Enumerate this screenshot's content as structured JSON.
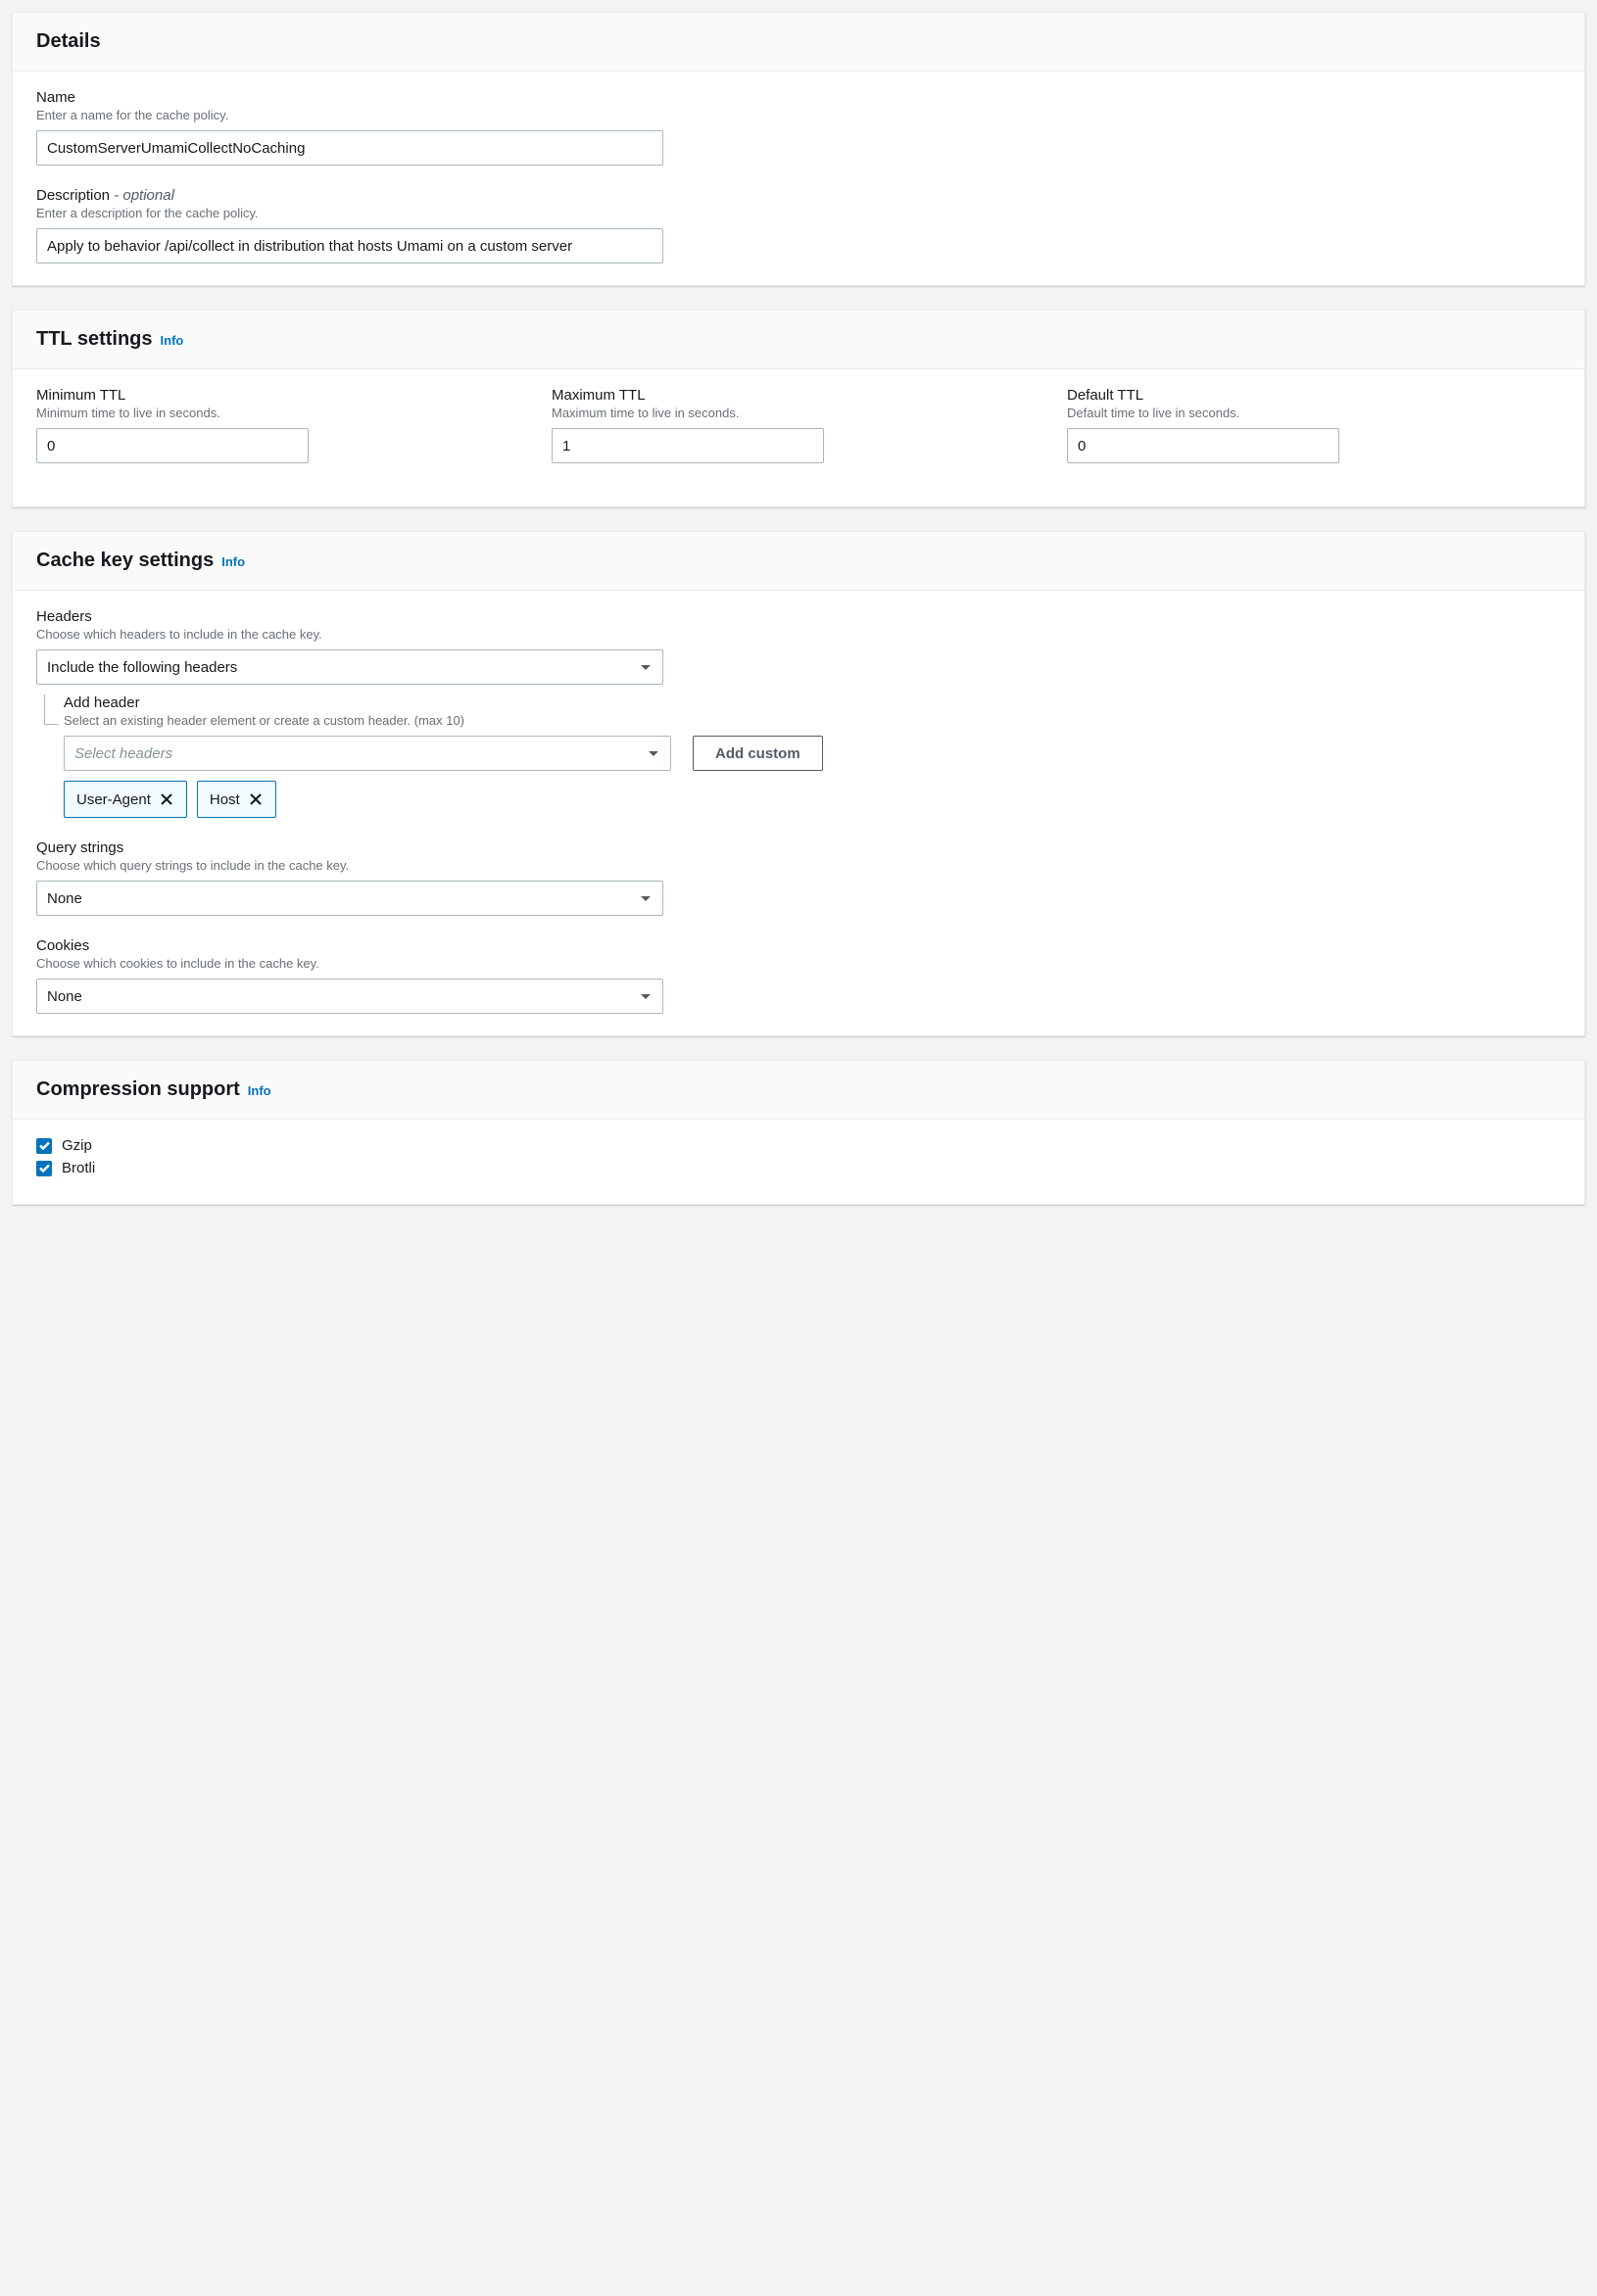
{
  "details": {
    "title": "Details",
    "name": {
      "label": "Name",
      "help": "Enter a name for the cache policy.",
      "value": "CustomServerUmamiCollectNoCaching"
    },
    "description": {
      "label": "Description",
      "optional": "- optional",
      "help": "Enter a description for the cache policy.",
      "value": "Apply to behavior /api/collect in distribution that hosts Umami on a custom server"
    }
  },
  "ttl": {
    "title": "TTL settings",
    "info": "Info",
    "min": {
      "label": "Minimum TTL",
      "help": "Minimum time to live in seconds.",
      "value": "0"
    },
    "max": {
      "label": "Maximum TTL",
      "help": "Maximum time to live in seconds.",
      "value": "1"
    },
    "default": {
      "label": "Default TTL",
      "help": "Default time to live in seconds.",
      "value": "0"
    }
  },
  "cachekey": {
    "title": "Cache key settings",
    "info": "Info",
    "headers": {
      "label": "Headers",
      "help": "Choose which headers to include in the cache key.",
      "selected": "Include the following headers",
      "add_label": "Add header",
      "add_help": "Select an existing header element or create a custom header. (max 10)",
      "placeholder": "Select headers",
      "add_custom_btn": "Add custom",
      "tokens": [
        "User-Agent",
        "Host"
      ]
    },
    "query": {
      "label": "Query strings",
      "help": "Choose which query strings to include in the cache key.",
      "selected": "None"
    },
    "cookies": {
      "label": "Cookies",
      "help": "Choose which cookies to include in the cache key.",
      "selected": "None"
    }
  },
  "compression": {
    "title": "Compression support",
    "info": "Info",
    "options": [
      {
        "label": "Gzip",
        "checked": true
      },
      {
        "label": "Brotli",
        "checked": true
      }
    ]
  }
}
